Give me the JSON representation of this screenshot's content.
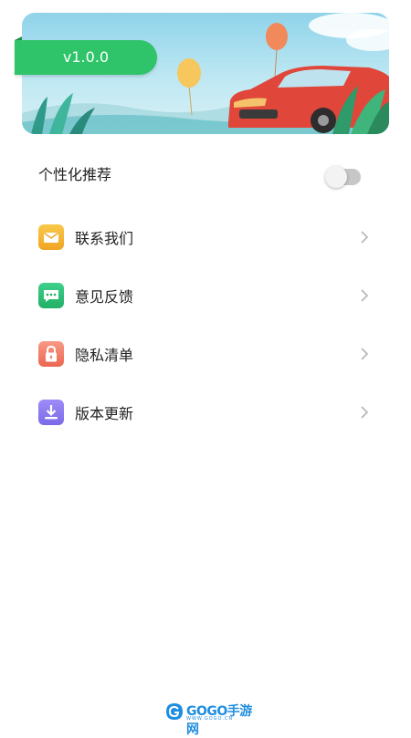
{
  "banner": {
    "version": "v1.0.0"
  },
  "settings": {
    "personalized_recommendation": {
      "label": "个性化推荐",
      "enabled": false
    }
  },
  "menu": [
    {
      "label": "联系我们",
      "icon": "mail-icon",
      "color": "#f2b533"
    },
    {
      "label": "意见反馈",
      "icon": "chat-icon",
      "color": "#2fc47c"
    },
    {
      "label": "隐私清单",
      "icon": "lock-icon",
      "color": "#f07c6a"
    },
    {
      "label": "版本更新",
      "icon": "download-icon",
      "color": "#8a7cf0"
    }
  ],
  "footer": {
    "logo_text": "GOGO手游网",
    "logo_url": "WWW.GOGO.CN"
  }
}
